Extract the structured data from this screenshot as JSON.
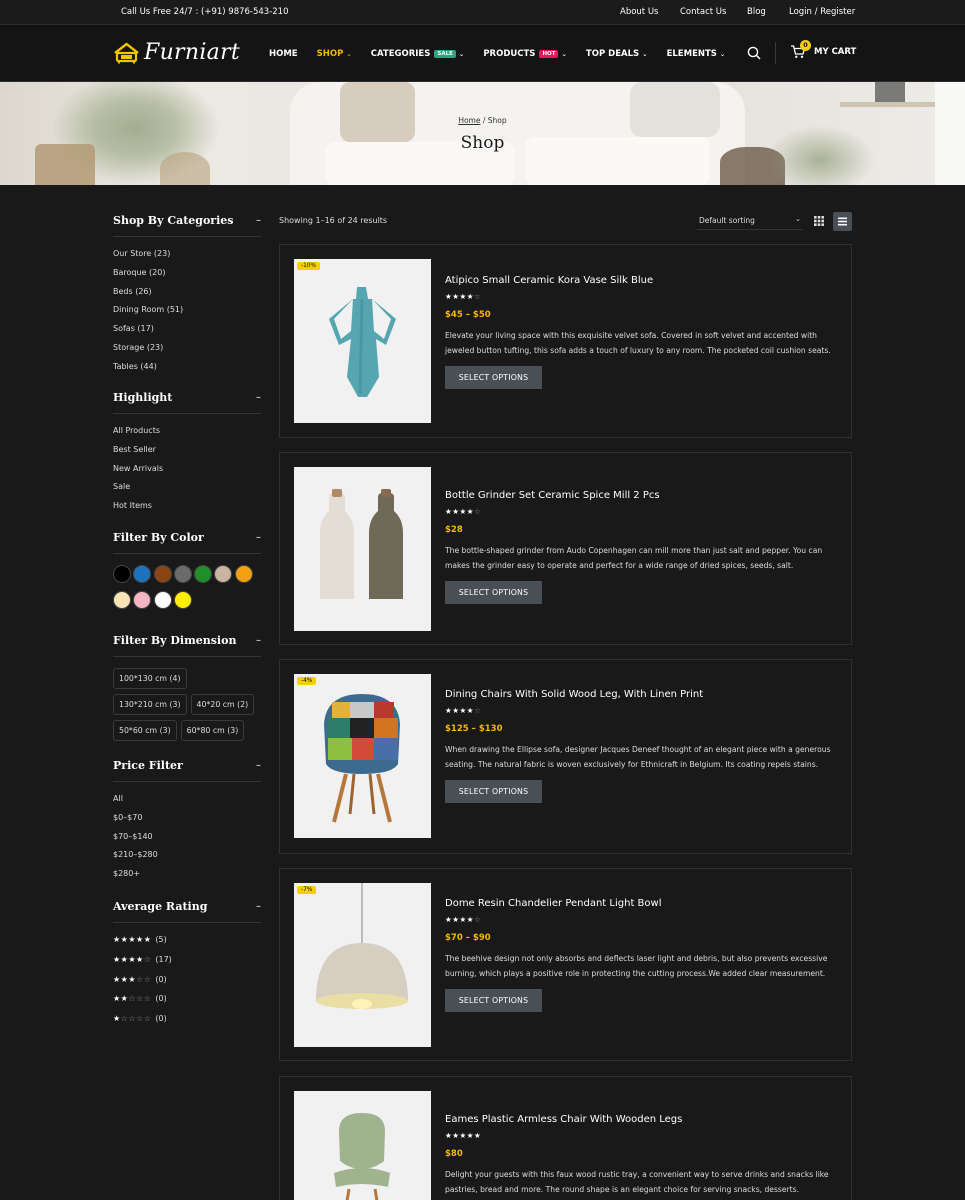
{
  "topbar": {
    "phone": "Call Us Free 24/7 : (+91) 9876-543-210",
    "links": [
      "About Us",
      "Contact Us",
      "Blog",
      "Login / Register"
    ]
  },
  "header": {
    "logo_text": "Furniart",
    "nav": [
      {
        "label": "HOME",
        "active": false,
        "dropdown": false,
        "tag": null
      },
      {
        "label": "SHOP",
        "active": true,
        "dropdown": true,
        "tag": null
      },
      {
        "label": "CATEGORIES",
        "active": false,
        "dropdown": true,
        "tag": "SALE",
        "tag_color": "#2aa37f"
      },
      {
        "label": "PRODUCTS",
        "active": false,
        "dropdown": true,
        "tag": "HOT",
        "tag_color": "#e8175d"
      },
      {
        "label": "TOP DEALS",
        "active": false,
        "dropdown": true,
        "tag": null
      },
      {
        "label": "ELEMENTS",
        "active": false,
        "dropdown": true,
        "tag": null
      }
    ],
    "cart_count": "0",
    "cart_label": "MY CART"
  },
  "hero": {
    "breadcrumb_home": "Home",
    "breadcrumb_sep": " / ",
    "breadcrumb_current": "Shop",
    "title": "Shop"
  },
  "toolbar": {
    "result_count": "Showing 1–16 of 24 results",
    "sorting": "Default sorting",
    "view_mode": "list"
  },
  "sidebar": {
    "categories": {
      "title": "Shop By Categories",
      "toggle": "–",
      "items": [
        "Our Store (23)",
        "Baroque (20)",
        "Beds (26)",
        "Dining Room (51)",
        "Sofas (17)",
        "Storage (23)",
        "Tables (44)"
      ]
    },
    "highlight": {
      "title": "Highlight",
      "toggle": "–",
      "items": [
        "All Products",
        "Best Seller",
        "New Arrivals",
        "Sale",
        "Hot Items"
      ]
    },
    "color": {
      "title": "Filter By Color",
      "toggle": "–",
      "swatches": [
        "#000000",
        "#1e73be",
        "#8b4513",
        "#6b6b6b",
        "#1f8f2a",
        "#c8b4a0",
        "#f0a010",
        "#f8e4b4",
        "#f4b4c4",
        "#ffffff",
        "#ffee00"
      ]
    },
    "dimension": {
      "title": "Filter By Dimension",
      "toggle": "–",
      "items": [
        "100*130 cm (4)",
        "130*210 cm (3)",
        "40*20 cm (2)",
        "50*60 cm (3)",
        "60*80 cm (3)"
      ]
    },
    "price": {
      "title": "Price Filter",
      "toggle": "–",
      "items": [
        "All",
        "$0–$70",
        "$70–$140",
        "$210–$280",
        "$280+"
      ]
    },
    "rating": {
      "title": "Average Rating",
      "toggle": "–",
      "items": [
        {
          "stars": 5,
          "count": "(5)"
        },
        {
          "stars": 4,
          "count": "(17)"
        },
        {
          "stars": 3,
          "count": "(0)"
        },
        {
          "stars": 2,
          "count": "(0)"
        },
        {
          "stars": 1,
          "count": "(0)"
        }
      ]
    }
  },
  "products": [
    {
      "badge": "-10%",
      "name": "Atipico Small Ceramic Kora Vase Silk Blue",
      "rating": 4,
      "price": "$45 – $50",
      "description": "Elevate your living space with this exquisite velvet sofa. Covered in soft velvet and accented with jeweled button tufting, this sofa adds a touch of luxury to any room. The pocketed coil cushion seats.",
      "button": "SELECT OPTIONS",
      "image": "vase-image"
    },
    {
      "badge": null,
      "name": "Bottle Grinder Set Ceramic Spice Mill 2 Pcs",
      "rating": 4,
      "price": "$28",
      "description": "The bottle-shaped grinder from Audo Copenhagen can mill more than just salt and pepper. You can makes the grinder easy to operate and perfect for a wide range of dried spices, seeds, salt.",
      "button": "SELECT OPTIONS",
      "image": "grinder-image"
    },
    {
      "badge": "-4%",
      "name": "Dining Chairs With Solid Wood Leg, With Linen Print",
      "rating": 4,
      "price": "$125 – $130",
      "description": "When drawing the Ellipse sofa, designer Jacques Deneef thought of an elegant piece with a generous seating. The natural fabric is woven exclusively for Ethnicraft in Belgium. Its coating repels stains.",
      "button": "SELECT OPTIONS",
      "image": "chair-image"
    },
    {
      "badge": "-7%",
      "name": "Dome Resin Chandelier Pendant Light Bowl",
      "rating": 4,
      "price": "$70 – $90",
      "description": "The beehive design not only absorbs and deflects laser light and debris, but also prevents excessive burning, which plays a positive role in protecting the cutting process.We added clear measurement.",
      "button": "SELECT OPTIONS",
      "image": "pendant-image"
    },
    {
      "badge": null,
      "name": "Eames Plastic Armless Chair With Wooden Legs",
      "rating": 5,
      "price": "$80",
      "description": "Delight your guests with this faux wood rustic tray, a convenient way to serve drinks and snacks like pastries, bread and more. The round shape is an elegant choice for serving snacks, desserts.",
      "button": "SELECT OPTIONS",
      "image": "eames-chair-image"
    }
  ]
}
